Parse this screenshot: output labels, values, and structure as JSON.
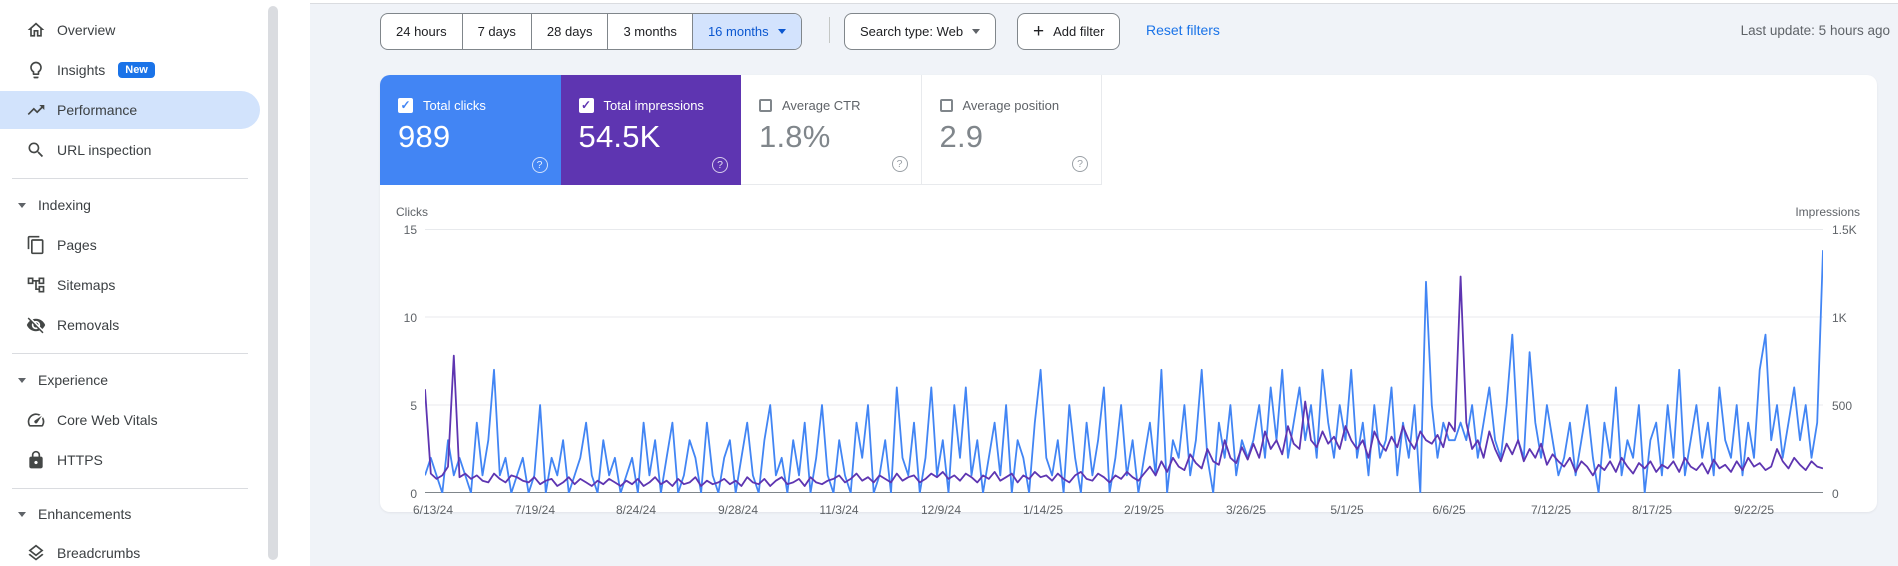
{
  "sidebar": {
    "items": [
      {
        "label": "Overview",
        "icon": "home-icon"
      },
      {
        "label": "Insights",
        "icon": "lightbulb-icon",
        "badge": "New"
      },
      {
        "label": "Performance",
        "icon": "trending-up-icon",
        "selected": true
      },
      {
        "label": "URL inspection",
        "icon": "search-icon"
      }
    ],
    "sections": [
      {
        "label": "Indexing",
        "items": [
          {
            "label": "Pages",
            "icon": "pages-icon"
          },
          {
            "label": "Sitemaps",
            "icon": "sitemap-icon"
          },
          {
            "label": "Removals",
            "icon": "eye-off-icon"
          }
        ]
      },
      {
        "label": "Experience",
        "items": [
          {
            "label": "Core Web Vitals",
            "icon": "speedometer-icon"
          },
          {
            "label": "HTTPS",
            "icon": "lock-icon"
          }
        ]
      },
      {
        "label": "Enhancements",
        "items": [
          {
            "label": "Breadcrumbs",
            "icon": "layers-icon"
          }
        ]
      }
    ]
  },
  "toolbar": {
    "date_ranges": [
      "24 hours",
      "7 days",
      "28 days",
      "3 months",
      "16 months"
    ],
    "selected_range": "16 months",
    "search_type_label": "Search type: Web",
    "add_filter_label": "Add filter",
    "reset_filters_label": "Reset filters",
    "last_update": "Last update: 5 hours ago"
  },
  "metrics": {
    "cards": [
      {
        "label": "Total clicks",
        "value": "989",
        "checked": true,
        "color": "#4285f4"
      },
      {
        "label": "Total impressions",
        "value": "54.5K",
        "checked": true,
        "color": "#5e35b1"
      },
      {
        "label": "Average CTR",
        "value": "1.8%",
        "checked": false
      },
      {
        "label": "Average position",
        "value": "2.9",
        "checked": false
      }
    ]
  },
  "chart_data": {
    "type": "line",
    "left_axis": {
      "label": "Clicks",
      "max": 15,
      "grid_values": [
        5,
        10,
        15
      ],
      "tick_labels": [
        "15",
        "10",
        "5",
        "0"
      ]
    },
    "right_axis": {
      "label": "Impressions",
      "max": 1500,
      "tick_labels": [
        "1.5K",
        "1K",
        "500",
        "0"
      ]
    },
    "x_labels": [
      "6/13/24",
      "7/19/24",
      "8/24/24",
      "9/28/24",
      "11/3/24",
      "12/9/24",
      "1/14/25",
      "2/19/25",
      "3/26/25",
      "5/1/25",
      "6/6/25",
      "7/12/25",
      "8/17/25",
      "9/22/25"
    ],
    "series": [
      {
        "name": "Clicks",
        "color": "#4285f4",
        "max": 15,
        "values": [
          1,
          2,
          1,
          0,
          3,
          1,
          2,
          1,
          0,
          4,
          1,
          3,
          7,
          1,
          2,
          0,
          1,
          2,
          0,
          1,
          5,
          0,
          2,
          1,
          3,
          0,
          1,
          2,
          4,
          1,
          0,
          3,
          1,
          2,
          0,
          1,
          2,
          0,
          4,
          1,
          3,
          0,
          2,
          4,
          0,
          1,
          3,
          2,
          0,
          4,
          1,
          0,
          2,
          3,
          0,
          2,
          4,
          1,
          0,
          3,
          5,
          1,
          2,
          0,
          3,
          1,
          4,
          0,
          2,
          5,
          1,
          0,
          3,
          1,
          0,
          4,
          2,
          5,
          0,
          1,
          3,
          0,
          6,
          2,
          1,
          4,
          0,
          2,
          6,
          1,
          3,
          0,
          5,
          2,
          6,
          1,
          3,
          0,
          2,
          4,
          1,
          5,
          0,
          3,
          2,
          0,
          4,
          7,
          2,
          1,
          3,
          0,
          5,
          2,
          0,
          4,
          1,
          3,
          6,
          0,
          2,
          5,
          1,
          3,
          0,
          2,
          4,
          1,
          7,
          0,
          3,
          2,
          5,
          1,
          3,
          7,
          2,
          0,
          4,
          2,
          5,
          1,
          3,
          2,
          3,
          5,
          2,
          6,
          3,
          7,
          2,
          4,
          6,
          3,
          5,
          2,
          7,
          4,
          2,
          5,
          3,
          7,
          2,
          4,
          1,
          5,
          2,
          3,
          6,
          1,
          4,
          2,
          5,
          0,
          12,
          5,
          2,
          4,
          3,
          3,
          4,
          3,
          5,
          2,
          4,
          6,
          3,
          2,
          5,
          9,
          3,
          2,
          8,
          4,
          2,
          5,
          3,
          1,
          2,
          4,
          1,
          3,
          5,
          2,
          0,
          4,
          2,
          6,
          1,
          3,
          2,
          5,
          0,
          3,
          4,
          1,
          5,
          2,
          7,
          1,
          3,
          5,
          2,
          4,
          1,
          6,
          3,
          2,
          5,
          1,
          4,
          2,
          7,
          9,
          3,
          5,
          2,
          4,
          6,
          3,
          5,
          2,
          4,
          13.8
        ]
      },
      {
        "name": "Impressions",
        "color": "#5e35b1",
        "max": 1500,
        "values": [
          590,
          110,
          80,
          100,
          150,
          780,
          90,
          110,
          80,
          100,
          70,
          60,
          110,
          80,
          60,
          100,
          90,
          70,
          60,
          90,
          50,
          70,
          80,
          40,
          60,
          90,
          50,
          80,
          60,
          40,
          70,
          50,
          80,
          60,
          40,
          70,
          50,
          80,
          40,
          60,
          90,
          50,
          70,
          40,
          80,
          50,
          60,
          90,
          40,
          70,
          50,
          60,
          80,
          50,
          70,
          40,
          90,
          60,
          50,
          80,
          40,
          70,
          90,
          50,
          60,
          80,
          40,
          90,
          60,
          50,
          70,
          80,
          100,
          60,
          80,
          110,
          70,
          90,
          60,
          100,
          80,
          60,
          110,
          70,
          90,
          100,
          60,
          80,
          110,
          90,
          120,
          80,
          100,
          70,
          110,
          90,
          60,
          100,
          80,
          120,
          70,
          90,
          110,
          60,
          100,
          80,
          120,
          90,
          100,
          70,
          110,
          80,
          60,
          100,
          120,
          80,
          70,
          110,
          90,
          60,
          100,
          80,
          120,
          90,
          70,
          110,
          150,
          100,
          180,
          120,
          200,
          150,
          130,
          220,
          170,
          140,
          250,
          180,
          160,
          300,
          200,
          170,
          260,
          190,
          280,
          200,
          350,
          250,
          300,
          220,
          380,
          280,
          250,
          520,
          300,
          260,
          350,
          280,
          320,
          250,
          380,
          300,
          250,
          300,
          200,
          350,
          280,
          240,
          320,
          260,
          380,
          300,
          250,
          350,
          300,
          280,
          330,
          260,
          400,
          350,
          1230,
          400,
          250,
          300,
          200,
          350,
          250,
          180,
          280,
          220,
          300,
          180,
          250,
          200,
          280,
          160,
          220,
          180,
          150,
          200,
          120,
          180,
          150,
          100,
          160,
          130,
          180,
          120,
          200,
          150,
          110,
          170,
          140,
          180,
          120,
          160,
          140,
          180,
          120,
          200,
          150,
          130,
          170,
          110,
          190,
          140,
          160,
          120,
          180,
          130,
          200,
          150,
          170,
          130,
          150,
          250,
          180,
          140,
          200,
          160,
          130,
          180,
          150,
          140
        ]
      }
    ]
  }
}
